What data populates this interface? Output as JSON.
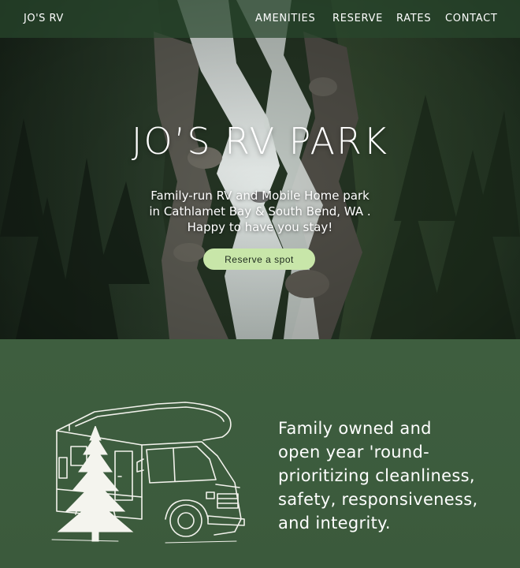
{
  "nav": {
    "brand": "JO'S RV",
    "links": [
      "AMENITIES",
      "RESERVE",
      "RATES",
      "CONTACT"
    ]
  },
  "hero": {
    "title": "JO’S RV PARK",
    "subtitle_lines": [
      "Family-run RV and Mobile Home park",
      "in Cathlamet Bay & South Bend, WA .",
      "Happy to have you stay!"
    ],
    "cta_label": "Reserve a spot"
  },
  "about": {
    "text_lines": [
      "Family owned and",
      "open year 'round-",
      "prioritizing cleanliness,",
      "safety, responsiveness,",
      "and integrity."
    ]
  },
  "colors": {
    "nav_bg": "#28462d",
    "section_bg": "#3d5c3e",
    "cta_bg": "#c8e6a9",
    "text": "#ffffff"
  },
  "icons": [
    "rv-camper-illustration",
    "pine-tree-illustration"
  ]
}
